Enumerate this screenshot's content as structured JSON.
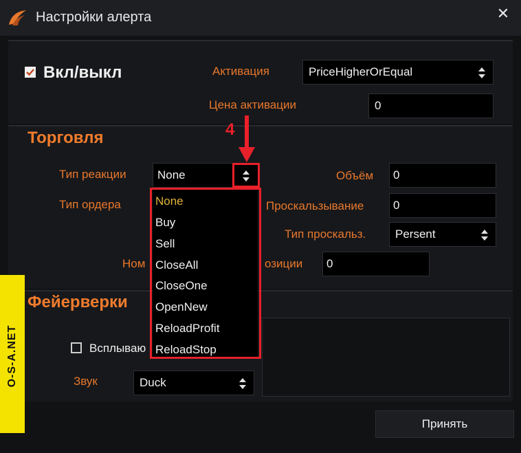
{
  "window": {
    "title": "Настройки алерта",
    "close_glyph": "✕"
  },
  "onoff": {
    "label": "Вкл/выкл",
    "checked": true
  },
  "activation": {
    "label": "Активация",
    "value": "PriceHigherOrEqual"
  },
  "activation_price": {
    "label": "Цена активации",
    "value": "0"
  },
  "trading": {
    "title": "Торговля",
    "reaction_type": {
      "label": "Тип реакции",
      "value": "None"
    },
    "order_type": {
      "label": "Тип ордера"
    },
    "volume": {
      "label": "Объём",
      "value": "0"
    },
    "slippage": {
      "label": "Проскальзывание",
      "value": "0"
    },
    "slippage_type": {
      "label": "Тип проскальз.",
      "value": "Persent"
    },
    "position_number": {
      "label_start": "Ном",
      "label_end": "озиции",
      "value": "0"
    }
  },
  "fireworks": {
    "title": "Фейерверки",
    "popup": {
      "label": "Всплываю",
      "checked": false
    },
    "sound": {
      "label": "Звук",
      "value": "Duck"
    }
  },
  "dropdown": {
    "items": [
      "None",
      "Buy",
      "Sell",
      "CloseAll",
      "CloseOne",
      "OpenNew",
      "ReloadProfit",
      "ReloadStop"
    ],
    "selected": "None"
  },
  "annotation": {
    "number": "4"
  },
  "watermark": {
    "text": "O-S-A.NET"
  },
  "accept_button": {
    "label": "Принять"
  },
  "colors": {
    "accent": "#e8782c",
    "annotation": "#e8202a",
    "watermark_bg": "#f4e300",
    "highlight_item": "#e0b238"
  }
}
